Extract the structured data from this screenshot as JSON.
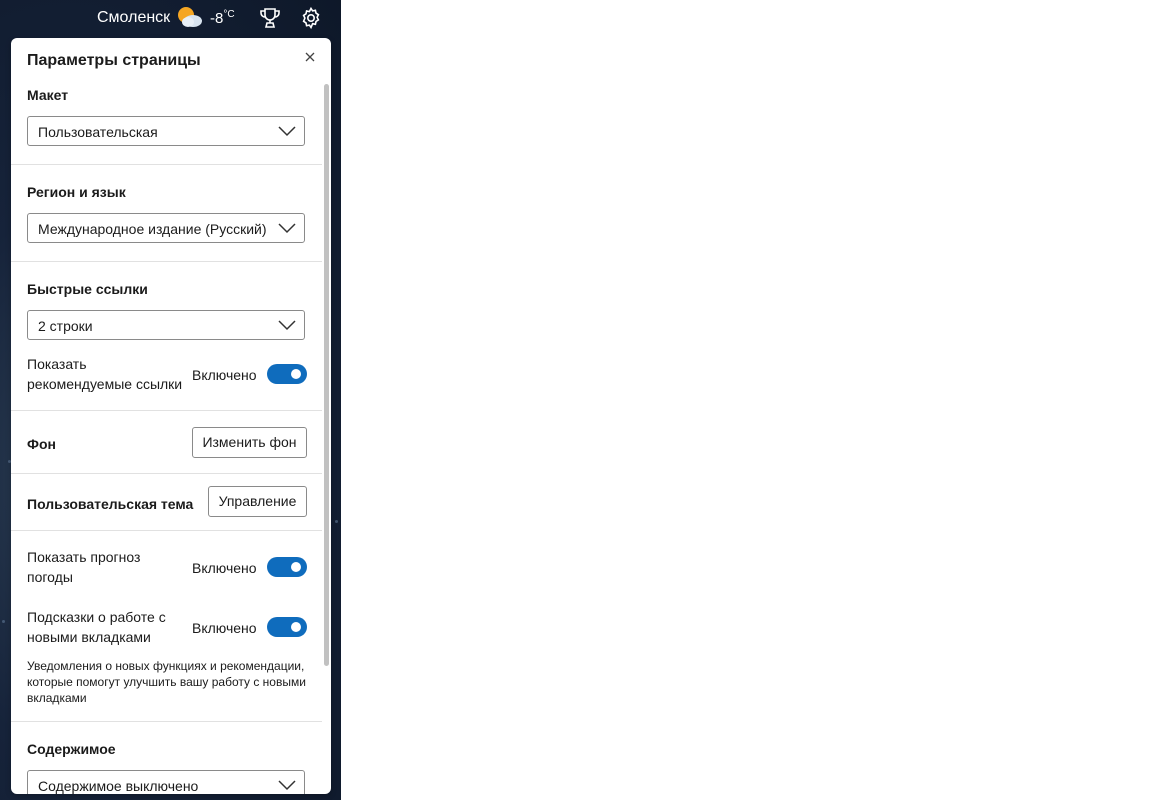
{
  "topbar": {
    "city": "Смоленск",
    "weather_icon": "partly-cloudy-icon",
    "temp_value": "-8",
    "temp_unit": "°C",
    "rewards_icon": "trophy-icon",
    "settings_icon": "gear-icon"
  },
  "panel": {
    "title": "Параметры страницы",
    "close_icon": "close-icon",
    "layout": {
      "label": "Макет",
      "value": "Пользовательская"
    },
    "region": {
      "label": "Регион и язык",
      "value": "Международное издание (Русский)"
    },
    "quick_links": {
      "label": "Быстрые ссылки",
      "value": "2 строки",
      "recommended_label": "Показать рекомендуемые ссылки",
      "recommended_state": "Включено"
    },
    "background": {
      "label": "Фон",
      "button": "Изменить фон"
    },
    "custom_theme": {
      "label": "Пользовательская тема",
      "button": "Управление"
    },
    "weather": {
      "label": "Показать прогноз погоды",
      "state": "Включено"
    },
    "tips": {
      "label": "Подсказки о работе с новыми вкладками",
      "state": "Включено",
      "description": "Уведомления о новых функциях и рекомендации, которые помогут улучшить вашу работу с новыми вкладками"
    },
    "content": {
      "label": "Содержимое",
      "value": "Содержимое выключено"
    }
  },
  "colors": {
    "accent": "#0f6cbd",
    "background_dark": "#16233a"
  }
}
